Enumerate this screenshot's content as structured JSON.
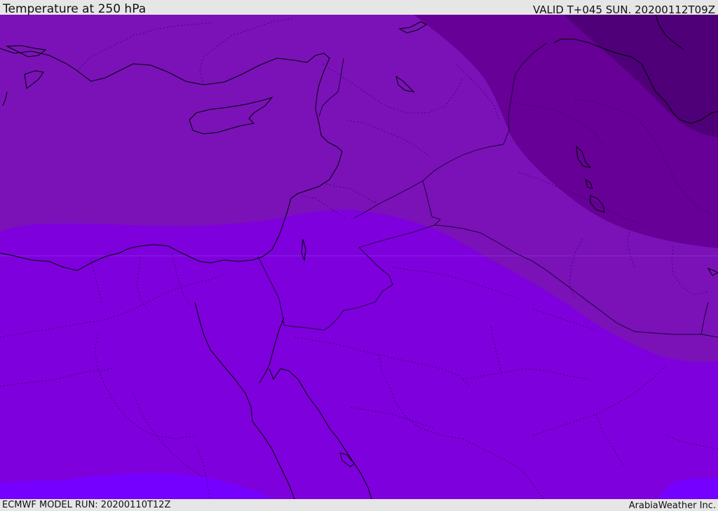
{
  "header": {
    "title": "Temperature at 250 hPa",
    "valid_time": "VALID T+045 SUN. 20200112T09Z"
  },
  "footer": {
    "model_run": "ECMWF MODEL RUN: 20200110T12Z",
    "credit": "ArabiaWeather Inc."
  },
  "map": {
    "field": "temperature",
    "level": "250 hPa",
    "colors": {
      "coldest": "#4f0078",
      "colder": "#660096",
      "cold": "#7a12b8",
      "mild": "#7e00dc",
      "warmer": "#7600ff",
      "coastline": "#000000",
      "border": "#1a0033"
    }
  }
}
